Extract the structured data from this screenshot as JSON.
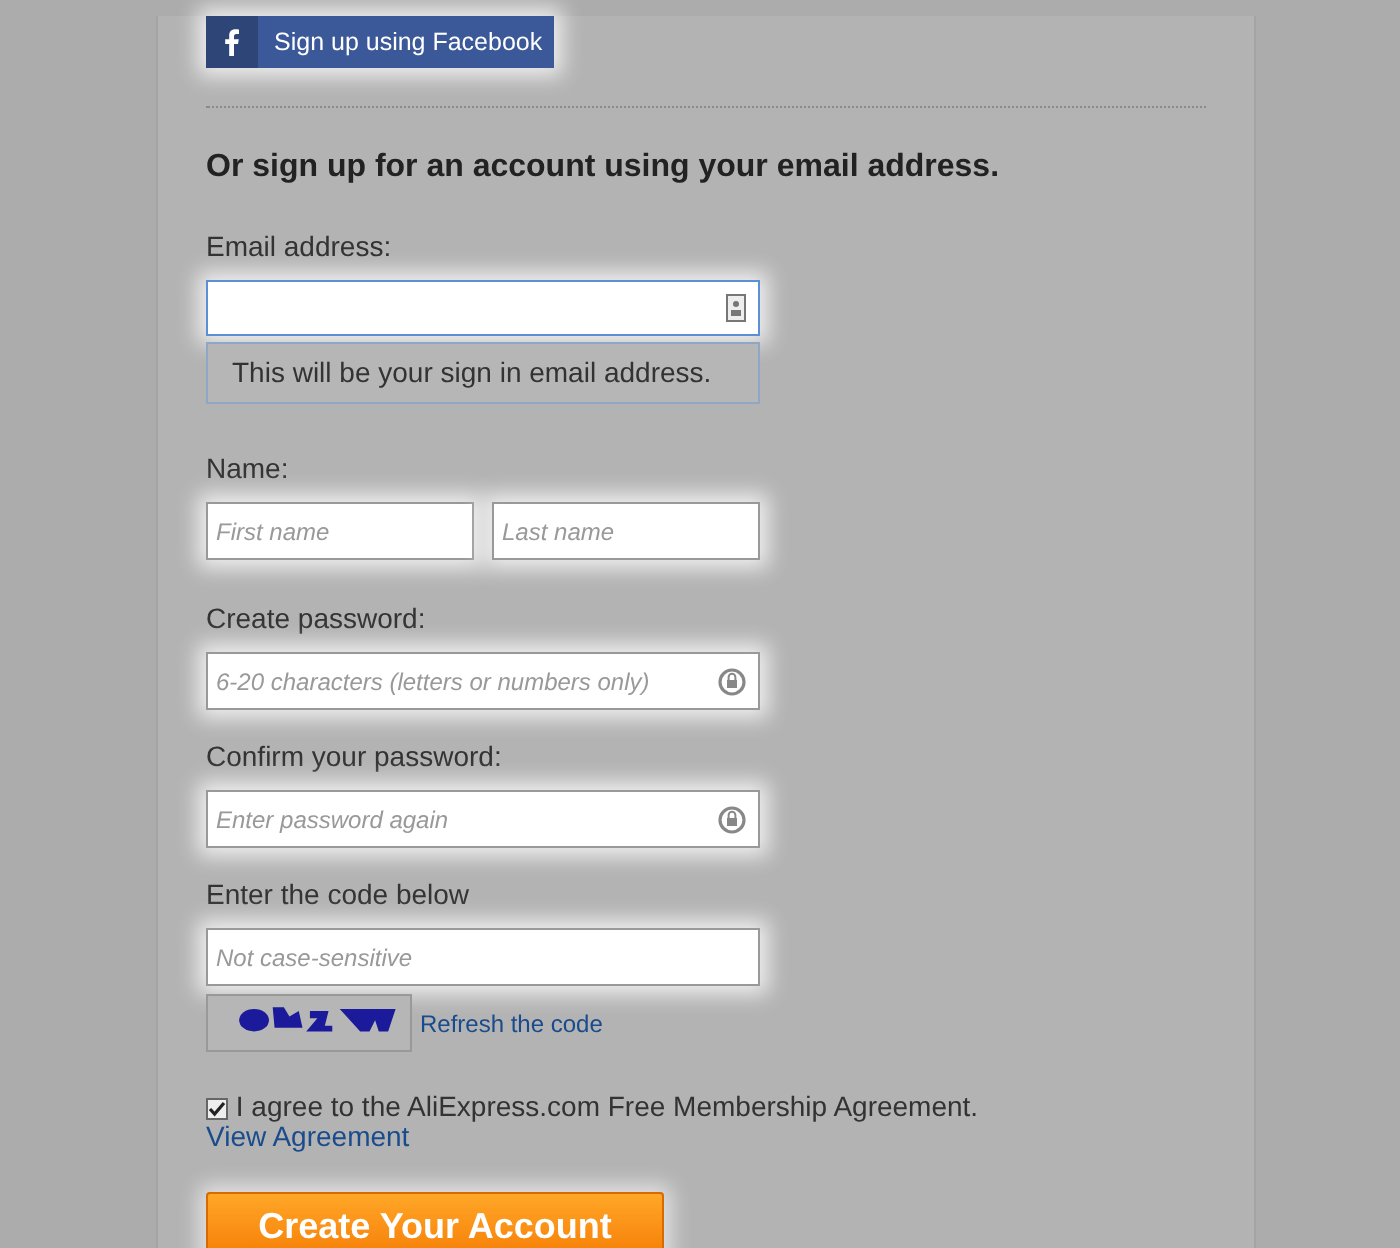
{
  "facebook_button": {
    "label": "Sign up using Facebook"
  },
  "heading": "Or sign up for an account using your email address.",
  "email": {
    "label": "Email address:",
    "hint": "This will be your sign in email address.",
    "focused": true
  },
  "name": {
    "label": "Name:",
    "first_placeholder": "First name",
    "last_placeholder": "Last name"
  },
  "password": {
    "label": "Create password:",
    "placeholder": "6-20 characters (letters or numbers only)"
  },
  "confirm_password": {
    "label": "Confirm your password:",
    "placeholder": "Enter password again"
  },
  "captcha": {
    "label": "Enter the code below",
    "placeholder": "Not case-sensitive",
    "refresh_link": "Refresh the code"
  },
  "agreement": {
    "checked": true,
    "text": "I agree to the AliExpress.com Free Membership Agreement.",
    "link": "View Agreement"
  },
  "submit_button": {
    "label": "Create Your Account"
  }
}
